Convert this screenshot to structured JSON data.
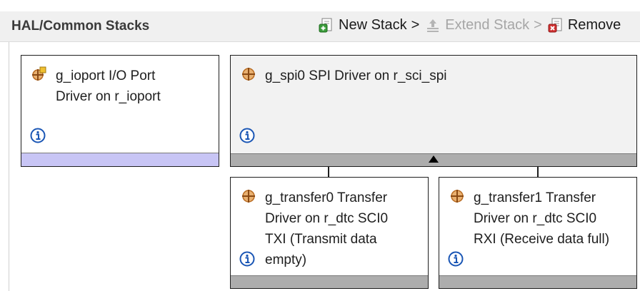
{
  "header": {
    "title": "HAL/Common Stacks",
    "toolbar": {
      "new_stack": "New Stack",
      "new_stack_sep": ">",
      "extend_stack": "Extend Stack",
      "extend_stack_sep": ">",
      "remove": "Remove"
    }
  },
  "modules": [
    {
      "line1": "g_ioport I/O Port",
      "line2": "Driver on r_ioport"
    },
    {
      "line1": "g_spi0 SPI Driver on r_sci_spi"
    },
    {
      "line1": "g_transfer0 Transfer",
      "line2": "Driver on r_dtc SCI0",
      "line3": "TXI (Transmit data",
      "line4": "empty)"
    },
    {
      "line1": "g_transfer1 Transfer",
      "line2": "Driver on r_dtc SCI0",
      "line3": "RXI (Receive data full)"
    }
  ],
  "icons": {
    "module": "module-gear-icon",
    "info": "info-icon",
    "new_stack": "new-stack-icon",
    "extend_stack": "extend-stack-icon",
    "remove": "remove-icon",
    "collapse": "collapse-arrow-icon"
  },
  "colors": {
    "module_icon": "#c0702a",
    "info_icon": "#1a56b5",
    "footer_purple": "#c8c5f5",
    "footer_gray": "#adadad"
  }
}
